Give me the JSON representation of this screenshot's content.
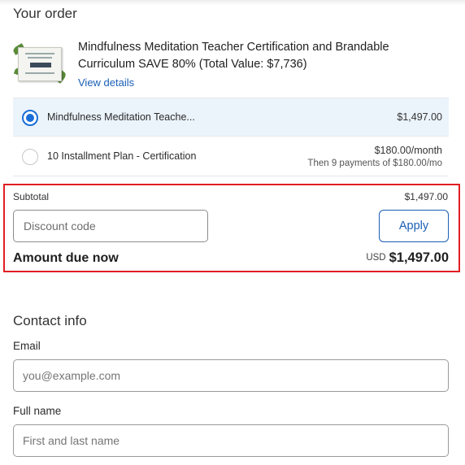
{
  "order": {
    "title": "Your order",
    "product": {
      "name": "Mindfulness Meditation Teacher Certification and Brandable Curriculum SAVE 80% (Total Value: $7,736)",
      "view_details": "View details",
      "thumbnail_icon": "certificate-image"
    },
    "plans": [
      {
        "label": "Mindfulness Meditation Teache...",
        "price": "$1,497.00",
        "sub": "",
        "selected": true
      },
      {
        "label": "10 Installment Plan - Certification",
        "price": "$180.00/month",
        "sub": "Then 9 payments of $180.00/mo",
        "selected": false
      }
    ],
    "subtotal": {
      "label": "Subtotal",
      "value": "$1,497.00"
    },
    "discount": {
      "placeholder": "Discount code",
      "value": "",
      "apply_label": "Apply"
    },
    "amount_due": {
      "label": "Amount due now",
      "currency": "USD",
      "value": "$1,497.00"
    }
  },
  "contact": {
    "title": "Contact info",
    "email": {
      "label": "Email",
      "placeholder": "you@example.com",
      "value": ""
    },
    "full_name": {
      "label": "Full name",
      "placeholder": "First and last name",
      "value": ""
    }
  },
  "colors": {
    "accent": "#1a5fb4",
    "radio_selected": "#1a6ed8",
    "selected_row_bg": "#ebf3fb",
    "highlight_border": "#e01e24"
  }
}
